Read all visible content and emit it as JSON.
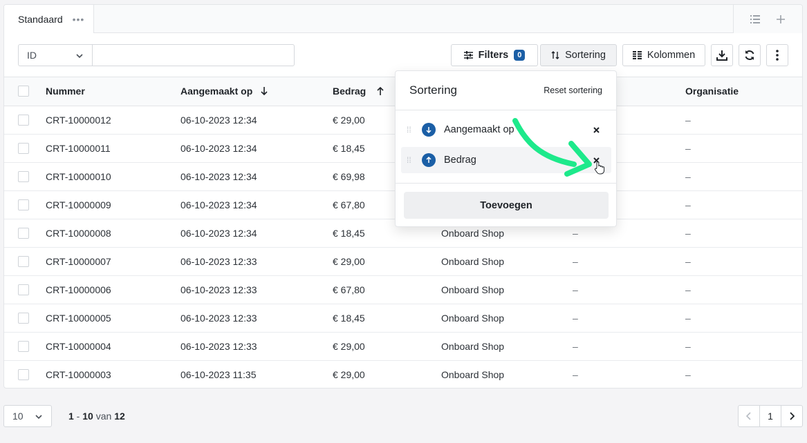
{
  "tab": {
    "label": "Standaard",
    "menu_icon": "more-horizontal-icon"
  },
  "tabbar_actions": {
    "list_icon": "list-icon",
    "add_icon": "plus-icon"
  },
  "toolbar": {
    "field_select": "ID",
    "search_value": "",
    "filters_label": "Filters",
    "filters_count": "0",
    "sort_label": "Sortering",
    "columns_label": "Kolommen"
  },
  "table": {
    "headers": [
      "Nummer",
      "Aangemaakt op",
      "Bedrag",
      "",
      "",
      "Organisatie"
    ],
    "sort_indicators": {
      "created": "desc",
      "amount": "asc"
    },
    "rows": [
      [
        "CRT-10000012",
        "06-10-2023 12:34",
        "€ 29,00",
        "",
        "",
        "–"
      ],
      [
        "CRT-10000011",
        "06-10-2023 12:34",
        "€ 18,45",
        "",
        "",
        "–"
      ],
      [
        "CRT-10000010",
        "06-10-2023 12:34",
        "€ 69,98",
        "",
        "",
        "–"
      ],
      [
        "CRT-10000009",
        "06-10-2023 12:34",
        "€ 67,80",
        "",
        "",
        "–"
      ],
      [
        "CRT-10000008",
        "06-10-2023 12:34",
        "€ 18,45",
        "Onboard Shop",
        "–",
        "–"
      ],
      [
        "CRT-10000007",
        "06-10-2023 12:33",
        "€ 29,00",
        "Onboard Shop",
        "–",
        "–"
      ],
      [
        "CRT-10000006",
        "06-10-2023 12:33",
        "€ 67,80",
        "Onboard Shop",
        "–",
        "–"
      ],
      [
        "CRT-10000005",
        "06-10-2023 12:33",
        "€ 18,45",
        "Onboard Shop",
        "–",
        "–"
      ],
      [
        "CRT-10000004",
        "06-10-2023 12:33",
        "€ 29,00",
        "Onboard Shop",
        "–",
        "–"
      ],
      [
        "CRT-10000003",
        "06-10-2023 11:35",
        "€ 29,00",
        "Onboard Shop",
        "–",
        "–"
      ]
    ]
  },
  "sort_popover": {
    "title": "Sortering",
    "reset_label": "Reset sortering",
    "items": [
      {
        "label": "Aangemaakt op",
        "direction": "desc"
      },
      {
        "label": "Bedrag",
        "direction": "asc"
      }
    ],
    "add_label": "Toevoegen"
  },
  "pagination": {
    "per_page": "10",
    "range_from": "1",
    "range_to": "10",
    "range_of": "van",
    "total": "12",
    "current_page": "1"
  },
  "colors": {
    "accent": "#1b5fa6",
    "annotation_arrow": "#1de98b"
  }
}
